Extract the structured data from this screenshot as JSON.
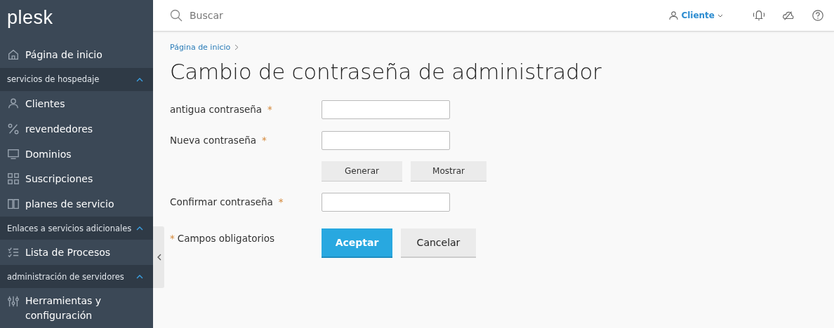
{
  "sidebar": {
    "logo": "plesk",
    "items": [
      {
        "kind": "link",
        "label": "Página de inicio"
      },
      {
        "kind": "section",
        "label": "servicios de hospedaje",
        "expanded": true
      },
      {
        "kind": "link",
        "label": "Clientes"
      },
      {
        "kind": "link",
        "label": "revendedores"
      },
      {
        "kind": "link",
        "label": "Dominios"
      },
      {
        "kind": "link",
        "label": "Suscripciones"
      },
      {
        "kind": "link",
        "label": "planes de servicio"
      },
      {
        "kind": "section",
        "label": "Enlaces a servicios adicionales",
        "expanded": true
      },
      {
        "kind": "link",
        "label": "Lista de Procesos"
      },
      {
        "kind": "section",
        "label": "administración de servidores",
        "expanded": true
      },
      {
        "kind": "link",
        "label": "Herramientas y configuración"
      }
    ]
  },
  "topbar": {
    "search": {
      "placeholder": "Buscar"
    },
    "user": "Cliente"
  },
  "breadcrumb": [
    "Página de inicio"
  ],
  "title": "Cambio de contraseña de administrador",
  "form": {
    "rows": [
      {
        "kind": "field",
        "label": "antigua contraseña",
        "required_mark": "*"
      },
      {
        "kind": "field",
        "label": "Nueva contraseña",
        "required_mark": "*"
      },
      {
        "kind": "buttons",
        "buttons": [
          "Generar",
          "Mostrar"
        ]
      },
      {
        "kind": "field",
        "label": "Confirmar contraseña",
        "required_mark": "*"
      }
    ],
    "note_mark": "*",
    "note": "Campos obligatorios",
    "actions": [
      {
        "label": "Aceptar",
        "kind": "primary"
      },
      {
        "label": "Cancelar",
        "kind": "secondary"
      }
    ]
  }
}
